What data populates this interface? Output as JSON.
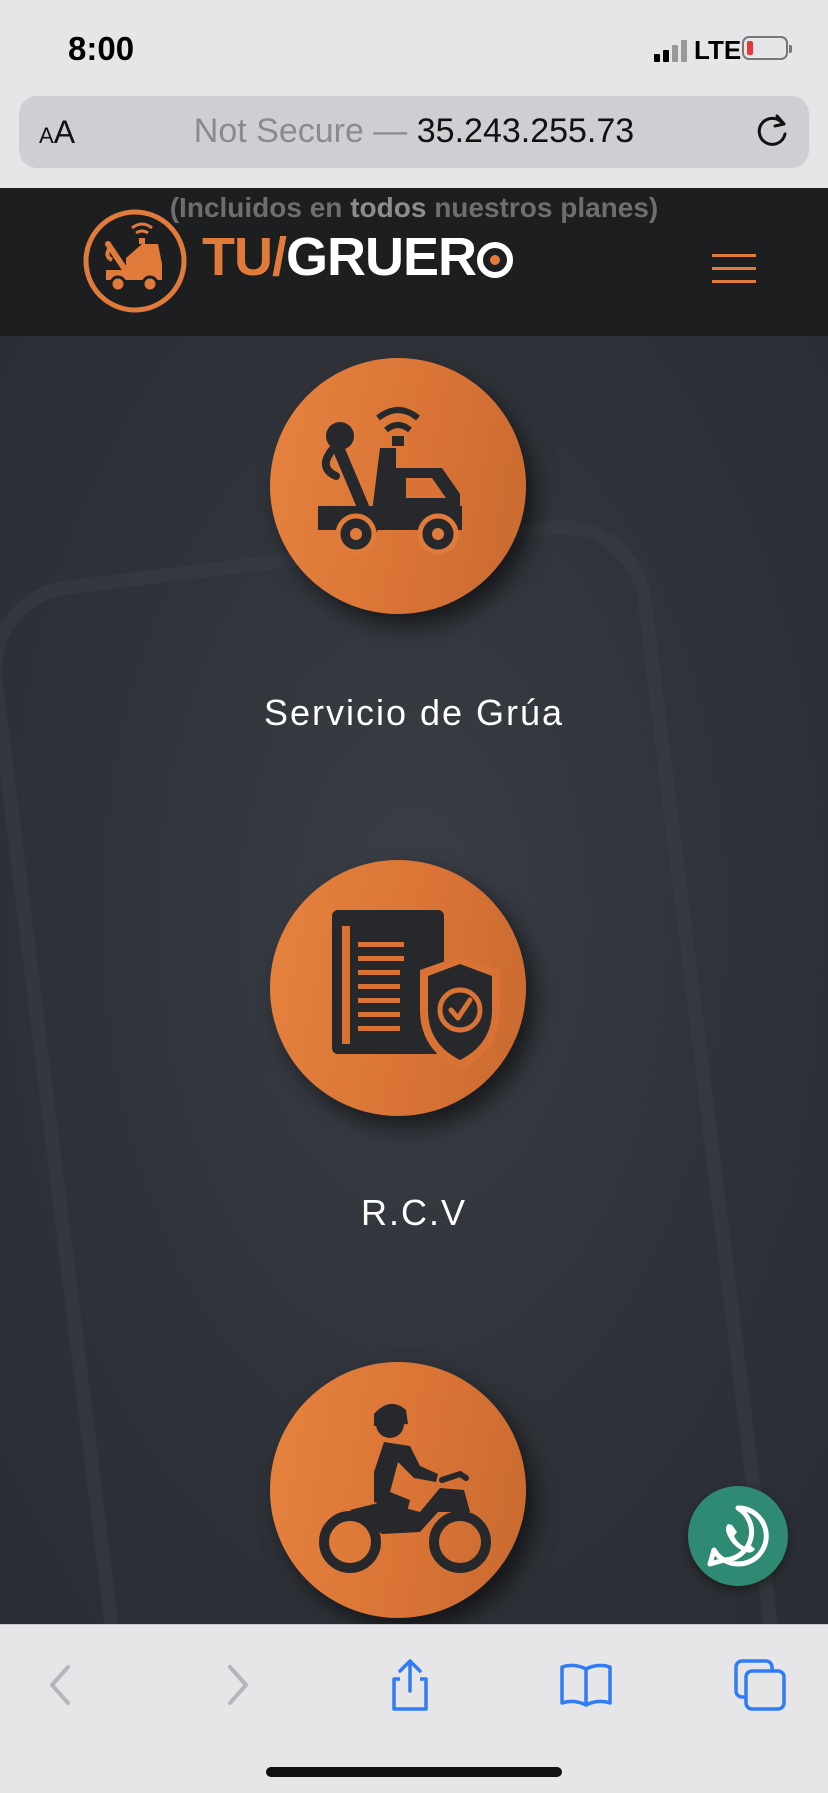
{
  "status": {
    "time": "8:00",
    "network": "LTE"
  },
  "browser": {
    "aa_small": "A",
    "aa_large": "A",
    "not_secure": "Not Secure —",
    "host": "35.243.255.73"
  },
  "header": {
    "included_pre": "(Incluidos en ",
    "included_bold": "todos",
    "included_post": " nuestros planes)",
    "logo_tu": "TU/",
    "logo_gr": "GRUER"
  },
  "services": [
    {
      "label": "Servicio de Grúa",
      "icon": "tow-truck-icon"
    },
    {
      "label": "R.C.V",
      "icon": "insurance-document-icon"
    },
    {
      "label": "",
      "icon": "motorcycle-icon"
    }
  ],
  "colors": {
    "accent": "#e07b3b",
    "header_bg": "#1d1e20",
    "page_bg": "#2f3339",
    "whatsapp": "#2f8a74",
    "ios_blue": "#2f7cf6"
  }
}
